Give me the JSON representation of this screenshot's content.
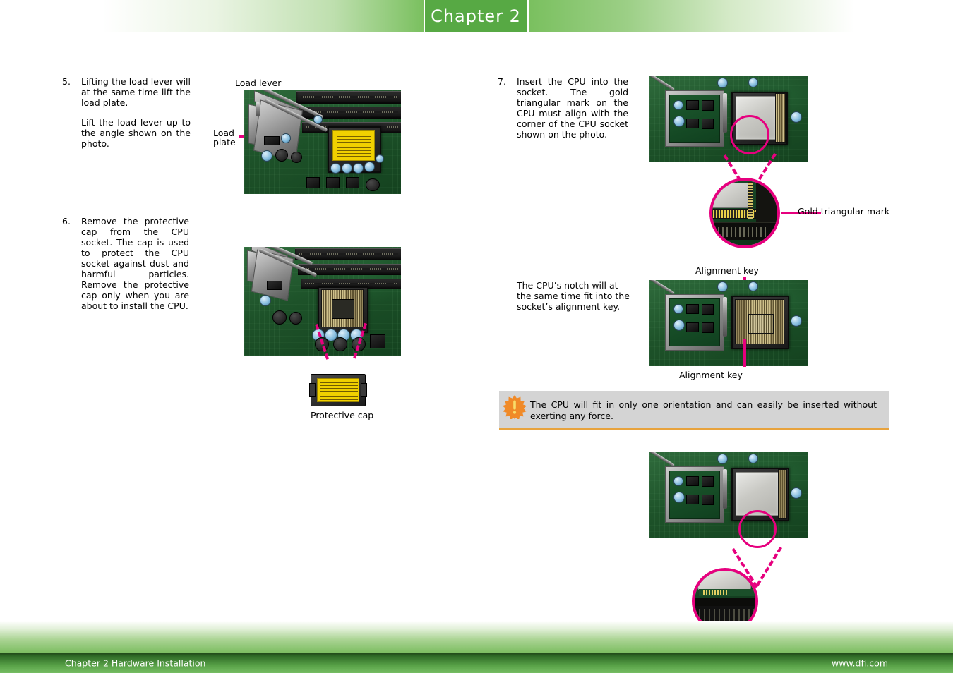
{
  "header": {
    "chapter_tab": "Chapter 2",
    "accent_green": "#57a944",
    "fade_green": "#7ac05f"
  },
  "footer": {
    "left_text": "Chapter 2 Hardware Installation",
    "right_text": "www.dfi.com"
  },
  "left_column": {
    "step5": {
      "number": "5.",
      "paragraph1": "Lifting the load lever will at the same time lift the load plate.",
      "paragraph2": "Lift the load lever up to the angle shown on the photo."
    },
    "step6": {
      "number": "6.",
      "paragraph1": "Remove the protective cap from the CPU socket. The cap is used to protect the CPU socket against dust and harmful particles. Remove the protective cap only when you are about to install the CPU."
    },
    "labels": {
      "load_lever": "Load lever",
      "load_plate": "Load\nplate",
      "protective_cap": "Protective cap"
    }
  },
  "right_column": {
    "step7": {
      "number": "7.",
      "paragraph1": "Insert the CPU into the socket. The gold triangular mark on the CPU must align with the corner of the CPU socket shown on the photo."
    },
    "notch_note": "The CPU’s notch will at the same time fit into the socket’s alignment key.",
    "labels": {
      "gold_triangular_mark": "Gold triangular mark",
      "alignment_key_top": "Alignment key",
      "alignment_key_bottom": "Alignment key"
    },
    "warning": {
      "icon": "warning-burst-icon",
      "text": "The CPU will fit in only one orientation and can easily be inserted without exerting any force.",
      "background": "#d4d4d4",
      "accent": "#e8a33d"
    }
  },
  "callout_color": "#e6007e"
}
